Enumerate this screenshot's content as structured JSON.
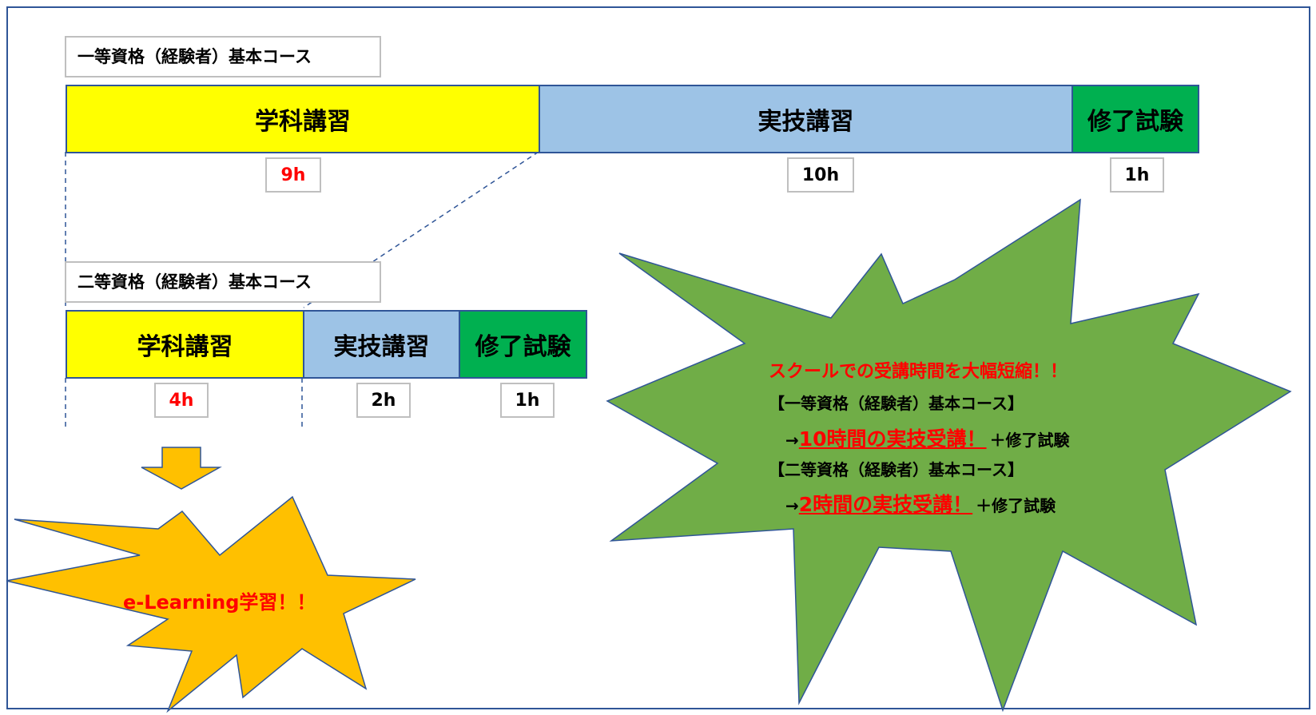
{
  "course1": {
    "title": "一等資格（経験者）基本コース",
    "segments": [
      {
        "label": "学科講習",
        "color": "#ffff00"
      },
      {
        "label": "実技講習",
        "color": "#9dc3e6"
      },
      {
        "label": "修了試験",
        "color": "#00b050"
      }
    ],
    "hours": [
      "9h",
      "10h",
      "1h"
    ]
  },
  "course2": {
    "title": "二等資格（経験者）基本コース",
    "segments": [
      {
        "label": "学科講習",
        "color": "#ffff00"
      },
      {
        "label": "実技講習",
        "color": "#9dc3e6"
      },
      {
        "label": "修了試験",
        "color": "#00b050"
      }
    ],
    "hours": [
      "4h",
      "2h",
      "1h"
    ]
  },
  "elearning_burst": {
    "text": "e-Learning学習！！",
    "color": "#ffc000"
  },
  "summary_burst": {
    "color": "#70ad47",
    "headline": "スクールでの受講時間を大幅短縮！！",
    "course1_label": "【一等資格（経験者）基本コース】",
    "course1_arrow": "→",
    "course1_highlight": "10時間の実技受講！",
    "course1_suffix": "＋修了試験",
    "course2_label": "【二等資格（経験者）基本コース】",
    "course2_arrow": "→",
    "course2_highlight": "2時間の実技受講！",
    "course2_suffix": "＋修了試験"
  },
  "colors": {
    "frame": "#2f5597",
    "accent_red": "#ff0000",
    "arrow": "#ffc000"
  }
}
